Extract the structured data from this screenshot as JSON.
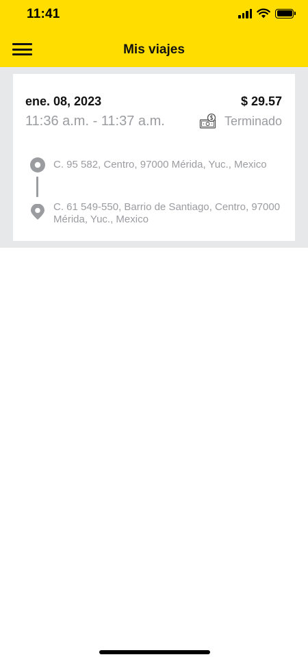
{
  "status_bar": {
    "time": "11:41",
    "icons": [
      "signal-icon",
      "wifi-icon",
      "battery-icon"
    ]
  },
  "header": {
    "title": "Mis viajes",
    "menu_icon": "hamburger-menu-icon",
    "background_color": "#FFDD00"
  },
  "trips": [
    {
      "date": "ene. 08, 2023",
      "price": "$ 29.57",
      "time_range": "11:36 a.m. - 11:37 a.m.",
      "status": "Terminado",
      "payment_icon": "cash-payment-icon",
      "origin": "C. 95 582, Centro, 97000 Mérida, Yuc., Mexico",
      "destination": "C. 61 549-550, Barrio de Santiago, Centro, 97000 Mérida, Yuc., Mexico"
    }
  ],
  "colors": {
    "accent": "#FFDD00",
    "list_background": "#E7E8EA",
    "secondary_text": "#9A9CA0"
  }
}
